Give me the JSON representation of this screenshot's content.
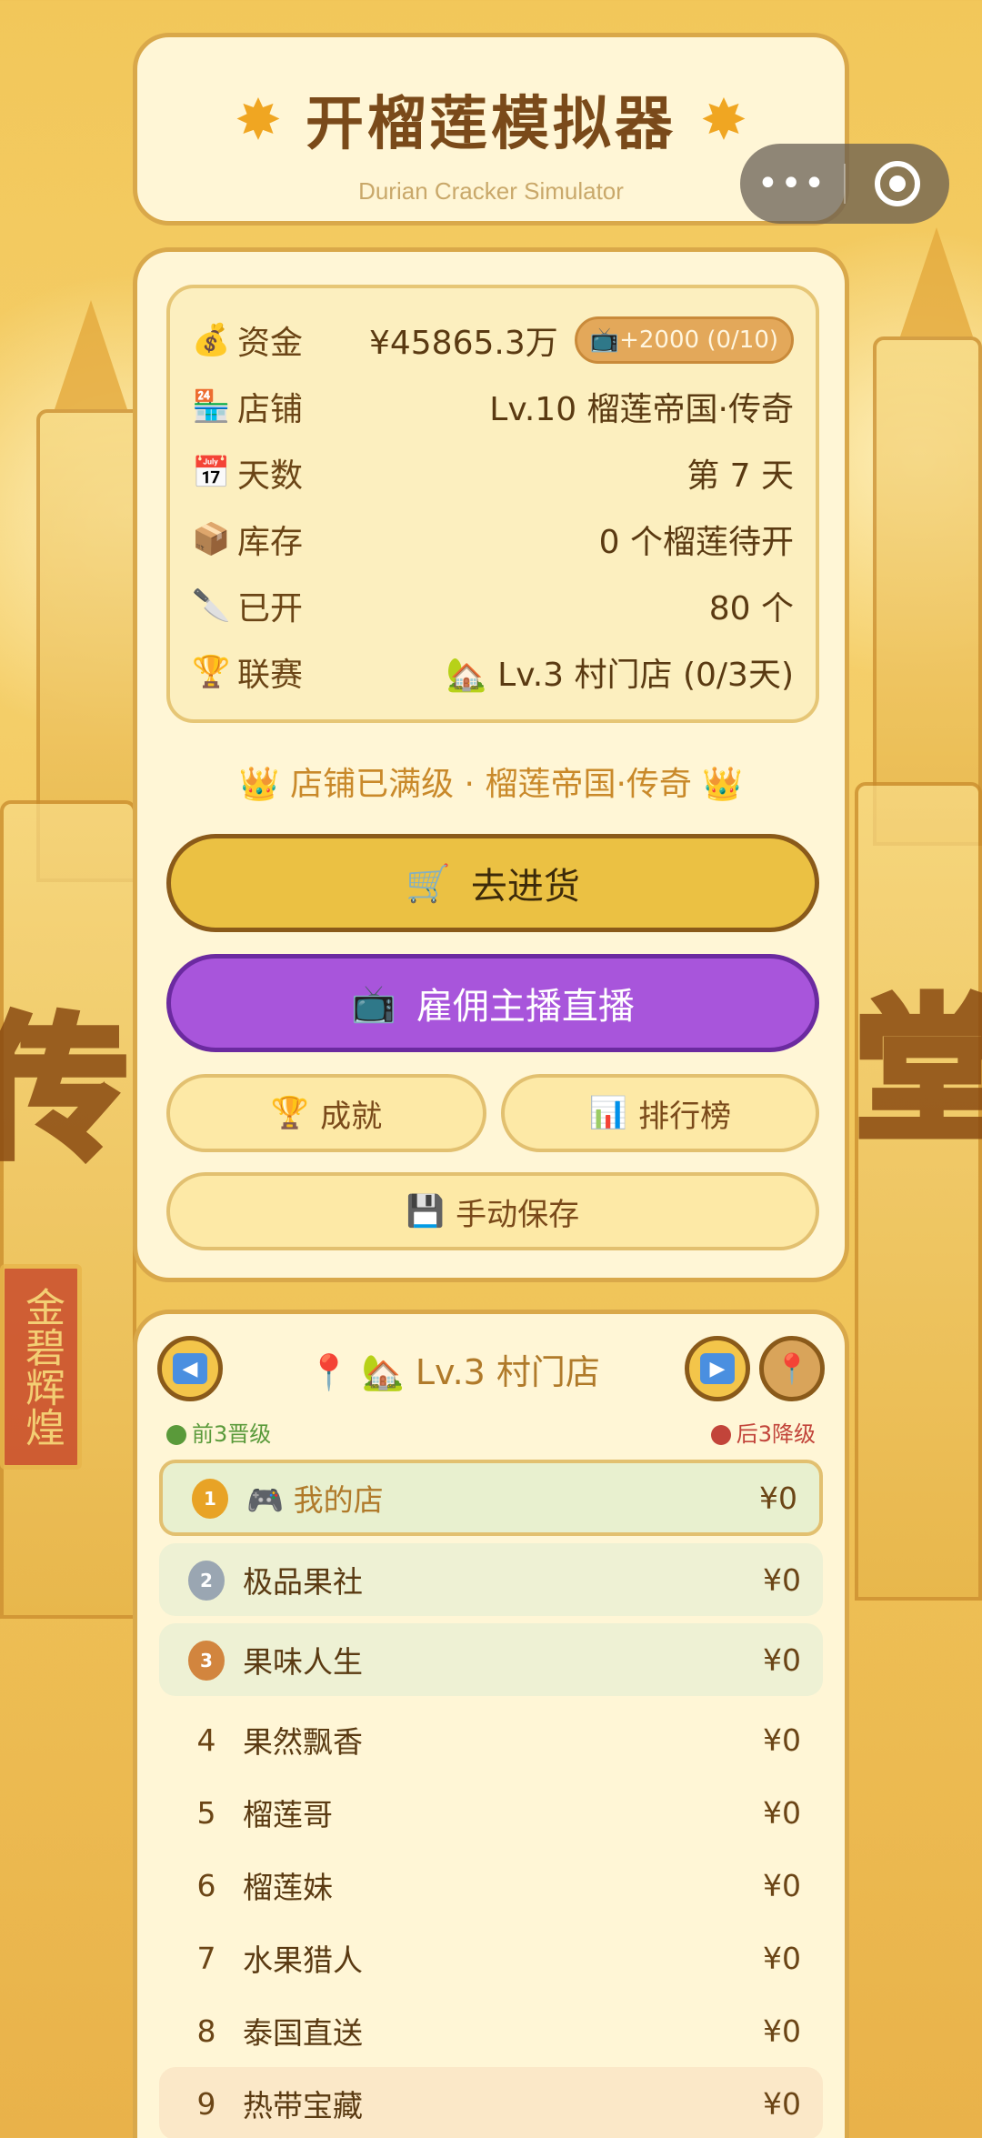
{
  "header": {
    "title": "开榴莲模拟器",
    "subtitle": "Durian Cracker Simulator",
    "star_glyph": "✸"
  },
  "capsule": {
    "more_label": "•••"
  },
  "stats": [
    {
      "icon": "💰",
      "label": "资金",
      "value": "¥45865.3万",
      "extra": "📺+2000 (0/10)"
    },
    {
      "icon": "🏪",
      "label": "店铺",
      "value": "Lv.10 榴莲帝国·传奇"
    },
    {
      "icon": "📅",
      "label": "天数",
      "value": "第 7 天"
    },
    {
      "icon": "📦",
      "label": "库存",
      "value": "0 个榴莲待开"
    },
    {
      "icon": "🔪",
      "label": "已开",
      "value": "80 个"
    },
    {
      "icon": "🏆",
      "label": "联赛",
      "value": "🏡 Lv.3 村门店 (0/3天)"
    }
  ],
  "max_note": "👑 店铺已满级 · 榴莲帝国·传奇 👑",
  "buttons": {
    "restock": {
      "icon": "🛒",
      "label": "去进货"
    },
    "livestream": {
      "icon": "📺",
      "label": "雇佣主播直播"
    },
    "achievements": {
      "icon": "🏆",
      "label": "成就"
    },
    "leaderboard": {
      "icon": "📊",
      "label": "排行榜"
    },
    "save": {
      "icon": "💾",
      "label": "手动保存"
    }
  },
  "league": {
    "title": "📍 🏡 Lv.3 村门店",
    "prev": "◀",
    "next": "▶",
    "pin": "📍",
    "legend_up": "前3晋级",
    "legend_down": "后3降级",
    "colors": {
      "up": "#5a9a3a",
      "down": "#c2443a",
      "highlight": "#e8f0cf"
    },
    "rows": [
      {
        "pos": "1",
        "name": "🎮 我的店",
        "money": "¥0"
      },
      {
        "pos": "2",
        "name": "极品果社",
        "money": "¥0"
      },
      {
        "pos": "3",
        "name": "果味人生",
        "money": "¥0"
      },
      {
        "pos": "4",
        "name": "果然飘香",
        "money": "¥0"
      },
      {
        "pos": "5",
        "name": "榴莲哥",
        "money": "¥0"
      },
      {
        "pos": "6",
        "name": "榴莲妹",
        "money": "¥0"
      },
      {
        "pos": "7",
        "name": "水果猎人",
        "money": "¥0"
      },
      {
        "pos": "8",
        "name": "泰国直送",
        "money": "¥0"
      },
      {
        "pos": "9",
        "name": "热带宝藏",
        "money": "¥0"
      }
    ]
  },
  "background": {
    "big_left": "传",
    "big_right": "堂",
    "banner": "金碧辉煌"
  }
}
